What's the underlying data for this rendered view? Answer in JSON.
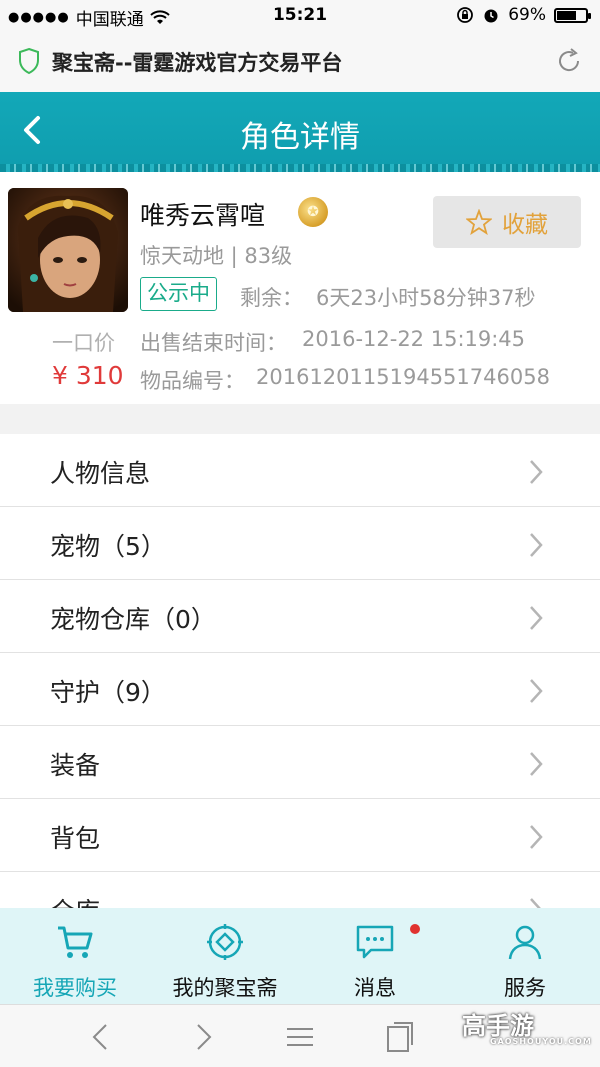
{
  "status_bar": {
    "signal": "●●●●●",
    "carrier": "中国联通",
    "wifi_icon": "wifi-icon",
    "time": "15:21",
    "battery_percent": "69%",
    "battery_level": 0.69
  },
  "browser": {
    "page_title": "聚宝斋--雷霆游戏官方交易平台"
  },
  "header": {
    "title": "角色详情"
  },
  "product": {
    "name": "唯秀云霄喧",
    "coin_icon": "gold-coin-icon",
    "favorite_label": "收藏",
    "server_level": "惊天动地 | 83级",
    "status": "公示中",
    "remaining_label": "剩余：",
    "remaining_value": "6天23小时58分钟37秒",
    "buyout_label": "一口价",
    "price": "¥ 310",
    "end_time_label": "出售结束时间：",
    "end_time_value": "2016-12-22 15:19:45",
    "item_id_label": "物品编号：",
    "item_id_value": "201612011519455174605​8"
  },
  "menu": [
    {
      "label": "人物信息"
    },
    {
      "label": "宠物（5）"
    },
    {
      "label": "宠物仓库（0）"
    },
    {
      "label": "守护（9）"
    },
    {
      "label": "装备"
    },
    {
      "label": "背包"
    },
    {
      "label": "仓库"
    }
  ],
  "tabs": [
    {
      "label": "我要购买",
      "icon": "cart-icon",
      "active": true
    },
    {
      "label": "我的聚宝斋",
      "icon": "treasure-icon",
      "active": false
    },
    {
      "label": "消息",
      "icon": "message-icon",
      "active": false,
      "has_notification": true
    },
    {
      "label": "服务",
      "icon": "user-icon",
      "active": false
    }
  ],
  "watermark": {
    "text": "高手游",
    "subtext": "GAOSHOUYOU.COM"
  },
  "colors": {
    "header": "#13a8b8",
    "price": "#e03a3a",
    "status": "#1aab8a",
    "favorite": "#e2a23b",
    "tab_active": "#16a6b6"
  }
}
